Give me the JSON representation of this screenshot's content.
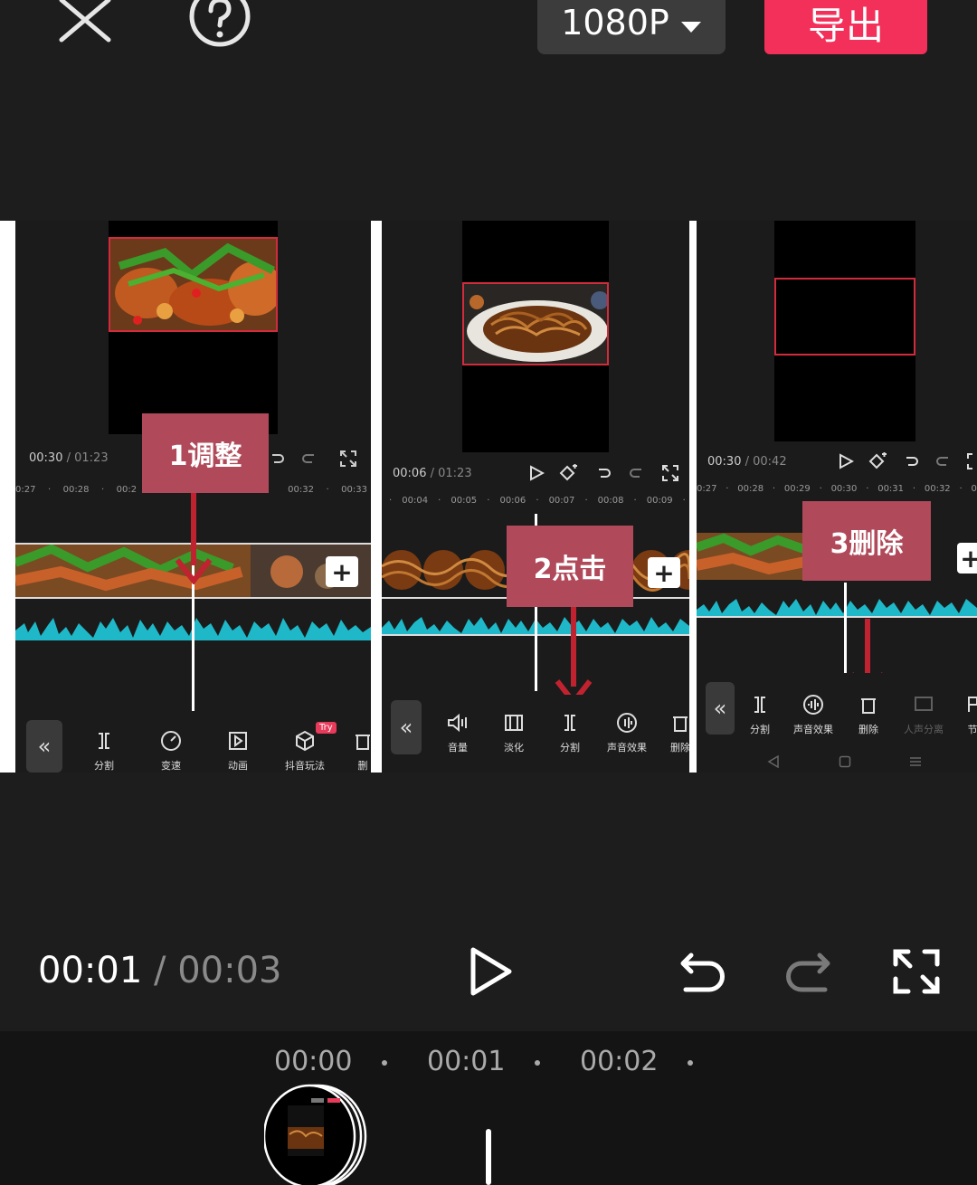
{
  "topbar": {
    "close_icon": "close-icon",
    "help_icon": "help-icon",
    "resolution_label": "1080P",
    "export_label": "导出",
    "export_color": "#f2305a"
  },
  "panels": [
    {
      "timecode_current": "00:30",
      "timecode_total": "01:23",
      "ruler": [
        "0:27",
        "00:28",
        "00:2",
        "00:32",
        "00:33"
      ],
      "callout": "1调整",
      "tools": [
        {
          "label": "分割",
          "icon": "split-icon"
        },
        {
          "label": "变速",
          "icon": "speed-icon"
        },
        {
          "label": "动画",
          "icon": "animation-icon"
        },
        {
          "label": "抖音玩法",
          "icon": "cube-icon",
          "badge": "Try"
        },
        {
          "label": "删",
          "icon": "delete-icon"
        }
      ]
    },
    {
      "timecode_current": "00:06",
      "timecode_total": "01:23",
      "ruler": [
        "00:04",
        "00:05",
        "00:06",
        "00:07",
        "00:08",
        "00:09"
      ],
      "callout": "2点击",
      "tools": [
        {
          "label": "音量",
          "icon": "volume-icon"
        },
        {
          "label": "淡化",
          "icon": "fade-icon"
        },
        {
          "label": "分割",
          "icon": "split-icon"
        },
        {
          "label": "声音效果",
          "icon": "sound-effect-icon"
        },
        {
          "label": "删除",
          "icon": "delete-icon"
        }
      ]
    },
    {
      "timecode_current": "00:30",
      "timecode_total": "00:42",
      "ruler": [
        "0:27",
        "00:28",
        "00:29",
        "00:30",
        "00:31",
        "00:32",
        "0"
      ],
      "callout": "3删除",
      "tools": [
        {
          "label": "分割",
          "icon": "split-icon"
        },
        {
          "label": "声音效果",
          "icon": "sound-effect-icon"
        },
        {
          "label": "删除",
          "icon": "delete-icon"
        },
        {
          "label": "人声分离",
          "icon": "voice-separate-icon"
        },
        {
          "label": "节",
          "icon": "beat-icon"
        }
      ]
    }
  ],
  "player": {
    "current": "00:01",
    "separator": "/",
    "total": "00:03"
  },
  "timeline": {
    "ruler": [
      "00:00",
      "00:01",
      "00:02"
    ]
  }
}
